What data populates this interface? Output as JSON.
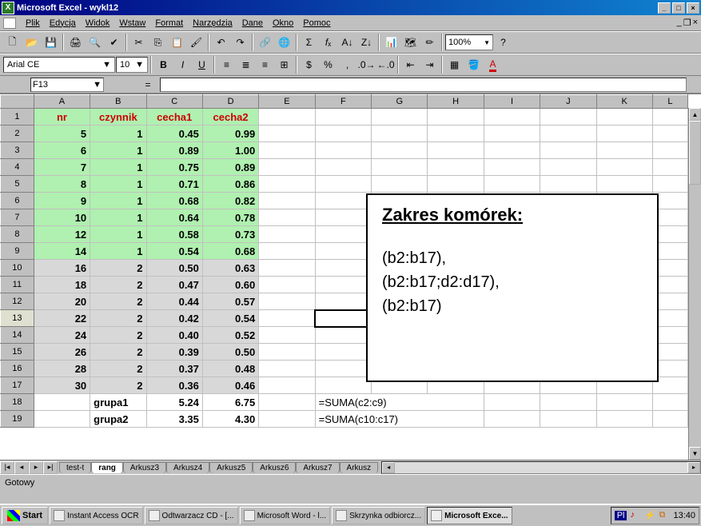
{
  "title": "Microsoft Excel - wykl12",
  "menus": [
    "Plik",
    "Edycja",
    "Widok",
    "Wstaw",
    "Format",
    "Narzędzia",
    "Dane",
    "Okno",
    "Pomoc"
  ],
  "font_name": "Arial CE",
  "font_size": "10",
  "zoom": "100%",
  "name_box": "F13",
  "formula": "",
  "columns": [
    "A",
    "B",
    "C",
    "D",
    "E",
    "F",
    "G",
    "H",
    "I",
    "J",
    "K",
    "L"
  ],
  "headers": {
    "A": "nr",
    "B": "czynnik",
    "C": "cecha1",
    "D": "cecha2"
  },
  "rows_green": [
    {
      "r": 2,
      "A": "5",
      "B": "1",
      "C": "0.45",
      "D": "0.99"
    },
    {
      "r": 3,
      "A": "6",
      "B": "1",
      "C": "0.89",
      "D": "1.00"
    },
    {
      "r": 4,
      "A": "7",
      "B": "1",
      "C": "0.75",
      "D": "0.89"
    },
    {
      "r": 5,
      "A": "8",
      "B": "1",
      "C": "0.71",
      "D": "0.86"
    },
    {
      "r": 6,
      "A": "9",
      "B": "1",
      "C": "0.68",
      "D": "0.82"
    },
    {
      "r": 7,
      "A": "10",
      "B": "1",
      "C": "0.64",
      "D": "0.78"
    },
    {
      "r": 8,
      "A": "12",
      "B": "1",
      "C": "0.58",
      "D": "0.73"
    },
    {
      "r": 9,
      "A": "14",
      "B": "1",
      "C": "0.54",
      "D": "0.68"
    }
  ],
  "rows_gray": [
    {
      "r": 10,
      "A": "16",
      "B": "2",
      "C": "0.50",
      "D": "0.63"
    },
    {
      "r": 11,
      "A": "18",
      "B": "2",
      "C": "0.47",
      "D": "0.60"
    },
    {
      "r": 12,
      "A": "20",
      "B": "2",
      "C": "0.44",
      "D": "0.57"
    },
    {
      "r": 13,
      "A": "22",
      "B": "2",
      "C": "0.42",
      "D": "0.54"
    },
    {
      "r": 14,
      "A": "24",
      "B": "2",
      "C": "0.40",
      "D": "0.52"
    },
    {
      "r": 15,
      "A": "26",
      "B": "2",
      "C": "0.39",
      "D": "0.50"
    },
    {
      "r": 16,
      "A": "28",
      "B": "2",
      "C": "0.37",
      "D": "0.48"
    },
    {
      "r": 17,
      "A": "30",
      "B": "2",
      "C": "0.36",
      "D": "0.46"
    }
  ],
  "summary_rows": [
    {
      "r": 18,
      "B": "grupa1",
      "C": "5.24",
      "D": "6.75",
      "F": "=SUMA(c2:c9)"
    },
    {
      "r": 19,
      "B": "grupa2",
      "C": "3.35",
      "D": "4.30",
      "F": "=SUMA(c10:c17)"
    }
  ],
  "overlay": {
    "title": "Zakres komórek:",
    "lines": [
      "(b2:b17),",
      "(b2:b17;d2:d17),",
      "(b2:b17)"
    ]
  },
  "tabs": [
    "test-t",
    "rang",
    "Arkusz3",
    "Arkusz4",
    "Arkusz5",
    "Arkusz6",
    "Arkusz7",
    "Arkusz"
  ],
  "active_tab": "rang",
  "status": "Gotowy",
  "start_label": "Start",
  "taskbar": [
    {
      "label": "Instant Access OCR",
      "active": false
    },
    {
      "label": "Odtwarzacz CD - [...",
      "active": false
    },
    {
      "label": "Microsoft Word - l...",
      "active": false
    },
    {
      "label": "Skrzynka odbiorcz...",
      "active": false
    },
    {
      "label": "Microsoft Exce...",
      "active": true
    }
  ],
  "tray_lang": "Pl",
  "clock": "13:40",
  "chart_data": {
    "type": "table",
    "title": "wykl12",
    "columns": [
      "nr",
      "czynnik",
      "cecha1",
      "cecha2"
    ],
    "rows": [
      [
        5,
        1,
        0.45,
        0.99
      ],
      [
        6,
        1,
        0.89,
        1.0
      ],
      [
        7,
        1,
        0.75,
        0.89
      ],
      [
        8,
        1,
        0.71,
        0.86
      ],
      [
        9,
        1,
        0.68,
        0.82
      ],
      [
        10,
        1,
        0.64,
        0.78
      ],
      [
        12,
        1,
        0.58,
        0.73
      ],
      [
        14,
        1,
        0.54,
        0.68
      ],
      [
        16,
        2,
        0.5,
        0.63
      ],
      [
        18,
        2,
        0.47,
        0.6
      ],
      [
        20,
        2,
        0.44,
        0.57
      ],
      [
        22,
        2,
        0.42,
        0.54
      ],
      [
        24,
        2,
        0.4,
        0.52
      ],
      [
        26,
        2,
        0.39,
        0.5
      ],
      [
        28,
        2,
        0.37,
        0.48
      ],
      [
        30,
        2,
        0.36,
        0.46
      ]
    ],
    "summary": {
      "grupa1": {
        "cecha1": 5.24,
        "cecha2": 6.75
      },
      "grupa2": {
        "cecha1": 3.35,
        "cecha2": 4.3
      }
    },
    "formulas": [
      "=SUMA(c2:c9)",
      "=SUMA(c10:c17)"
    ]
  }
}
